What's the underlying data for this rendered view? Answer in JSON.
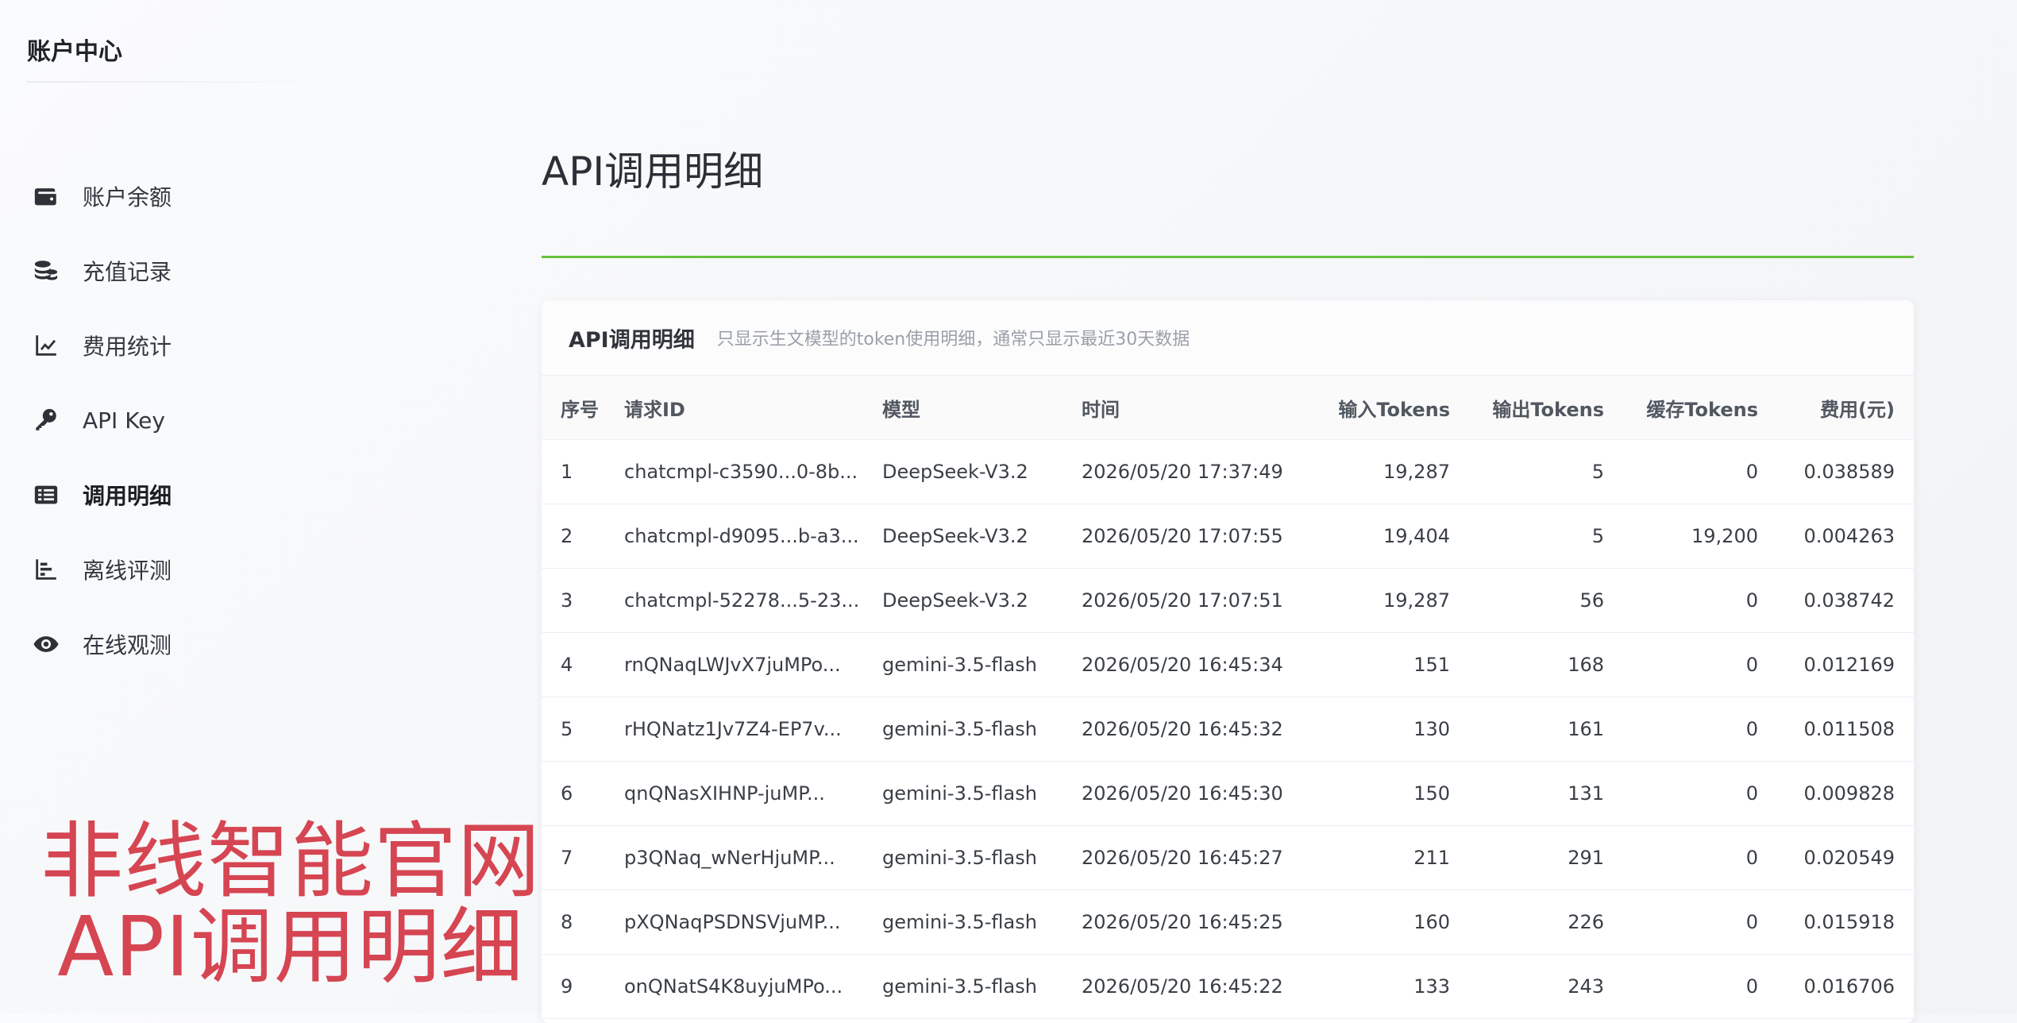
{
  "sidebar": {
    "title": "账户中心",
    "items": [
      {
        "label": "账户余额",
        "icon": "wallet-icon"
      },
      {
        "label": "充值记录",
        "icon": "coins-icon"
      },
      {
        "label": "费用统计",
        "icon": "line-chart-icon"
      },
      {
        "label": "API Key",
        "icon": "key-icon"
      },
      {
        "label": "调用明细",
        "icon": "list-icon",
        "active": true
      },
      {
        "label": "离线评测",
        "icon": "bar-chart-icon"
      },
      {
        "label": "在线观测",
        "icon": "eye-icon"
      }
    ]
  },
  "watermark": {
    "line1": "非线智能官网",
    "line2": "API调用明细"
  },
  "main": {
    "title": "API调用明细",
    "card": {
      "title": "API调用明细",
      "desc": "只显示生文模型的token使用明细，通常只显示最近30天数据",
      "columns": [
        "序号",
        "请求ID",
        "模型",
        "时间",
        "输入Tokens",
        "输出Tokens",
        "缓存Tokens",
        "费用(元)"
      ],
      "rows": [
        [
          "1",
          "chatcmpl-c3590...0-8b...",
          "DeepSeek-V3.2",
          "2026/05/20 17:37:49",
          "19,287",
          "5",
          "0",
          "0.038589"
        ],
        [
          "2",
          "chatcmpl-d9095...b-a3...",
          "DeepSeek-V3.2",
          "2026/05/20 17:07:55",
          "19,404",
          "5",
          "19,200",
          "0.004263"
        ],
        [
          "3",
          "chatcmpl-52278...5-23...",
          "DeepSeek-V3.2",
          "2026/05/20 17:07:51",
          "19,287",
          "56",
          "0",
          "0.038742"
        ],
        [
          "4",
          "rnQNaqLWJvX7juMPo...",
          "gemini-3.5-flash",
          "2026/05/20 16:45:34",
          "151",
          "168",
          "0",
          "0.012169"
        ],
        [
          "5",
          "rHQNatz1Jv7Z4-EP7v...",
          "gemini-3.5-flash",
          "2026/05/20 16:45:32",
          "130",
          "161",
          "0",
          "0.011508"
        ],
        [
          "6",
          "qnQNasXIHNP-juMP...",
          "gemini-3.5-flash",
          "2026/05/20 16:45:30",
          "150",
          "131",
          "0",
          "0.009828"
        ],
        [
          "7",
          "p3QNaq_wNerHjuMP...",
          "gemini-3.5-flash",
          "2026/05/20 16:45:27",
          "211",
          "291",
          "0",
          "0.020549"
        ],
        [
          "8",
          "pXQNaqPSDNSVjuMP...",
          "gemini-3.5-flash",
          "2026/05/20 16:45:25",
          "160",
          "226",
          "0",
          "0.015918"
        ],
        [
          "9",
          "onQNatS4K8uyjuMPo...",
          "gemini-3.5-flash",
          "2026/05/20 16:45:22",
          "133",
          "243",
          "0",
          "0.016706"
        ]
      ]
    }
  },
  "colors": {
    "accent_line": "#67c23a",
    "watermark": "#d64552"
  }
}
